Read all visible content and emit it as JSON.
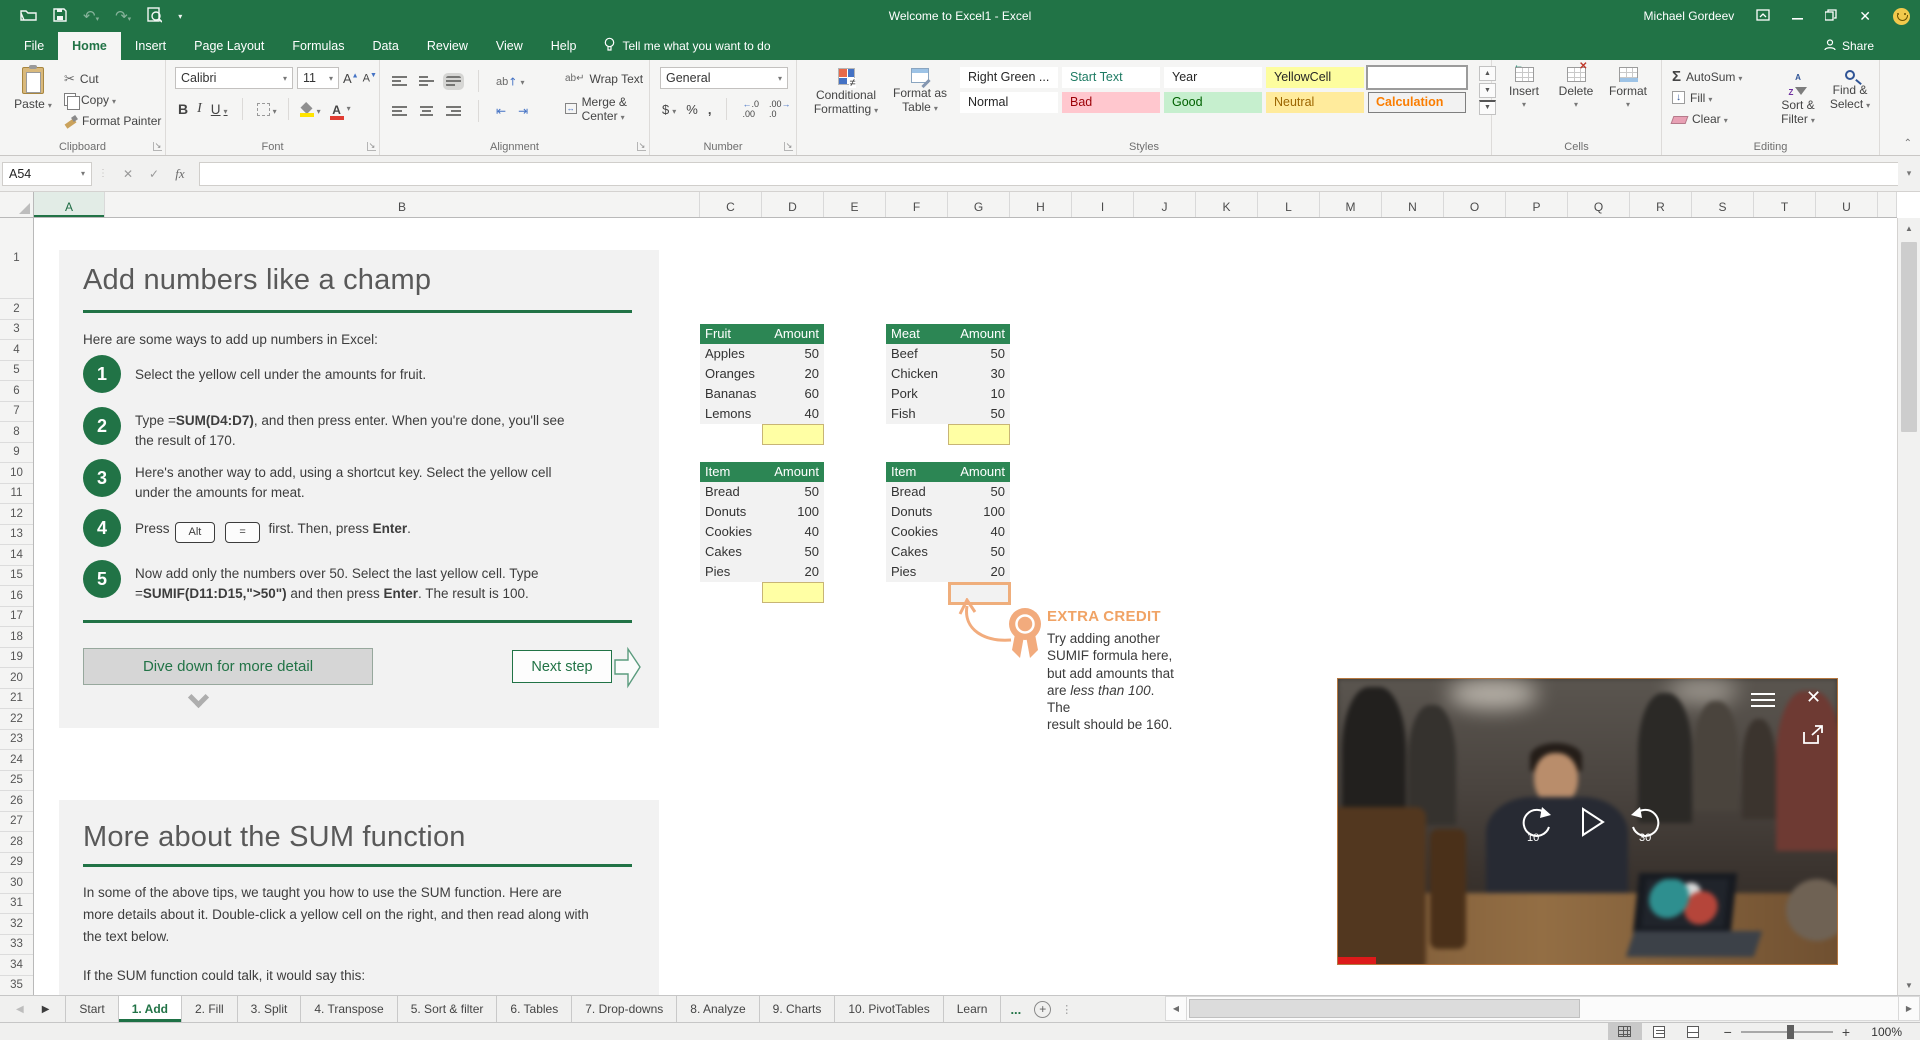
{
  "window": {
    "title": "Welcome to Excel1  -  Excel",
    "user": "Michael Gordeev",
    "share_label": "Share",
    "tell_me": "Tell me what you want to do"
  },
  "ribbon_tabs": [
    {
      "label": "File",
      "active": false
    },
    {
      "label": "Home",
      "active": true
    },
    {
      "label": "Insert",
      "active": false
    },
    {
      "label": "Page Layout",
      "active": false
    },
    {
      "label": "Formulas",
      "active": false
    },
    {
      "label": "Data",
      "active": false
    },
    {
      "label": "Review",
      "active": false
    },
    {
      "label": "View",
      "active": false
    },
    {
      "label": "Help",
      "active": false
    }
  ],
  "ribbon": {
    "clipboard": {
      "label": "Clipboard",
      "paste": "Paste",
      "cut": "Cut",
      "copy": "Copy",
      "format_painter": "Format Painter"
    },
    "font": {
      "label": "Font",
      "family": "Calibri",
      "size": "11"
    },
    "alignment": {
      "label": "Alignment",
      "wrap_text": "Wrap Text",
      "merge_center": "Merge & Center"
    },
    "number": {
      "label": "Number",
      "format": "General"
    },
    "styles": {
      "label": "Styles",
      "conditional_1": "Conditional",
      "conditional_2": "Formatting",
      "format_table_1": "Format as",
      "format_table_2": "Table",
      "gallery": [
        {
          "label": "Right Green ...",
          "fg": "#262626",
          "bg": "#ffffff"
        },
        {
          "label": "Start Text",
          "fg": "#1e7b63",
          "bg": "#ffffff"
        },
        {
          "label": "Year",
          "fg": "#262626",
          "bg": "#ffffff"
        },
        {
          "label": "YellowCell",
          "fg": "#262626",
          "bg": "#fdfd9e"
        },
        {
          "label": "",
          "fg": "#262626",
          "bg": "#ffffff",
          "selected": true
        },
        {
          "label": "Normal",
          "fg": "#262626",
          "bg": "#ffffff"
        },
        {
          "label": "Bad",
          "fg": "#9c0006",
          "bg": "#ffc7ce"
        },
        {
          "label": "Good",
          "fg": "#006100",
          "bg": "#c6efce"
        },
        {
          "label": "Neutral",
          "fg": "#9c6500",
          "bg": "#ffeb9c"
        },
        {
          "label": "Calculation",
          "fg": "#fa7d00",
          "bg": "#f2f2f2",
          "bold": true,
          "border": true
        }
      ]
    },
    "cells": {
      "label": "Cells",
      "insert": "Insert",
      "delete": "Delete",
      "format": "Format"
    },
    "editing": {
      "label": "Editing",
      "autosum": "AutoSum",
      "fill": "Fill",
      "clear": "Clear",
      "sort_1": "Sort &",
      "sort_2": "Filter",
      "find_1": "Find &",
      "find_2": "Select"
    }
  },
  "formula_bar": {
    "name_box": "A54",
    "formula": "",
    "cancel_icon": "✕",
    "enter_icon": "✓",
    "fx_icon": "fx"
  },
  "grid": {
    "columns": [
      "A",
      "B",
      "C",
      "D",
      "E",
      "F",
      "G",
      "H",
      "I",
      "J",
      "K",
      "L",
      "M",
      "N",
      "O",
      "P",
      "Q",
      "R",
      "S",
      "T",
      "U"
    ],
    "rows": [
      1,
      2,
      3,
      4,
      5,
      6,
      7,
      8,
      9,
      10,
      11,
      12,
      13,
      14,
      15,
      16,
      17,
      18,
      19,
      20,
      21,
      22,
      23,
      24,
      25,
      26,
      27,
      28,
      29,
      30,
      31,
      32,
      33,
      34,
      35
    ]
  },
  "panel1": {
    "title": "Add numbers like a champ",
    "intro": "Here are some ways to add up numbers in Excel:",
    "steps": [
      {
        "num": "1",
        "lines": [
          [
            {
              "t": "Select the yellow cell under the amounts for fruit."
            }
          ]
        ]
      },
      {
        "num": "2",
        "lines": [
          [
            {
              "t": "Type ="
            },
            {
              "t": "SUM(D4:D7)",
              "b": true
            },
            {
              "t": ", and then press enter. When you're done, you'll see"
            }
          ],
          [
            {
              "t": "the result of 170."
            }
          ]
        ]
      },
      {
        "num": "3",
        "lines": [
          [
            {
              "t": "Here's another way to add, using a shortcut key. Select the yellow cell"
            }
          ],
          [
            {
              "t": "under the amounts for meat."
            }
          ]
        ]
      },
      {
        "num": "4",
        "lines": [
          [
            {
              "t": "Press"
            },
            {
              "k": "Alt"
            },
            {
              "k": "="
            },
            {
              "t": " first. Then, press "
            },
            {
              "t": "Enter",
              "b": true
            },
            {
              "t": "."
            }
          ]
        ]
      },
      {
        "num": "5",
        "lines": [
          [
            {
              "t": "Now add only the numbers over 50. Select the last yellow cell. Type"
            }
          ],
          [
            {
              "t": "="
            },
            {
              "t": "SUMIF(D11:D15,\">50\")",
              "b": true
            },
            {
              "t": " and then press "
            },
            {
              "t": "Enter",
              "b": true
            },
            {
              "t": ". The result is 100."
            }
          ]
        ]
      }
    ],
    "dive_button": "Dive down for more detail",
    "next_button": "Next step"
  },
  "tables": {
    "fruit": {
      "headers": [
        "Fruit",
        "Amount"
      ],
      "rows": [
        [
          "Apples",
          "50"
        ],
        [
          "Oranges",
          "20"
        ],
        [
          "Bananas",
          "60"
        ],
        [
          "Lemons",
          "40"
        ]
      ],
      "footer": "yellow"
    },
    "meat": {
      "headers": [
        "Meat",
        "Amount"
      ],
      "rows": [
        [
          "Beef",
          "50"
        ],
        [
          "Chicken",
          "30"
        ],
        [
          "Pork",
          "10"
        ],
        [
          "Fish",
          "50"
        ]
      ],
      "footer": "yellow"
    },
    "item1": {
      "headers": [
        "Item",
        "Amount"
      ],
      "rows": [
        [
          "Bread",
          "50"
        ],
        [
          "Donuts",
          "100"
        ],
        [
          "Cookies",
          "40"
        ],
        [
          "Cakes",
          "50"
        ],
        [
          "Pies",
          "20"
        ]
      ],
      "footer": "yellow"
    },
    "item2": {
      "headers": [
        "Item",
        "Amount"
      ],
      "rows": [
        [
          "Bread",
          "50"
        ],
        [
          "Donuts",
          "100"
        ],
        [
          "Cookies",
          "40"
        ],
        [
          "Cakes",
          "50"
        ],
        [
          "Pies",
          "20"
        ]
      ],
      "footer": "orange"
    }
  },
  "extra_credit": {
    "heading": "EXTRA CREDIT",
    "lines": [
      [
        {
          "t": "Try adding another"
        }
      ],
      [
        {
          "t": "SUMIF formula here,"
        }
      ],
      [
        {
          "t": "but add amounts that"
        }
      ],
      [
        {
          "t": "are "
        },
        {
          "t": "less than 100",
          "i": true
        },
        {
          "t": ". The"
        }
      ],
      [
        {
          "t": "result should be 160."
        }
      ]
    ]
  },
  "panel2": {
    "title": "More about the SUM function",
    "para1_lines": [
      "In some of the above tips, we taught you how to use the SUM function. Here are",
      "more details about it. Double-click a yellow cell on the right, and then read along with",
      "the text below."
    ],
    "para2": "If the SUM function could talk, it would say this:"
  },
  "video": {
    "rewind_label": "10",
    "forward_label": "30"
  },
  "sheet_tabs": {
    "tabs": [
      {
        "label": "Start",
        "active": false
      },
      {
        "label": "1. Add",
        "active": true
      },
      {
        "label": "2. Fill",
        "active": false
      },
      {
        "label": "3. Split",
        "active": false
      },
      {
        "label": "4. Transpose",
        "active": false
      },
      {
        "label": "5. Sort & filter",
        "active": false
      },
      {
        "label": "6. Tables",
        "active": false
      },
      {
        "label": "7. Drop-downs",
        "active": false
      },
      {
        "label": "8. Analyze",
        "active": false
      },
      {
        "label": "9. Charts",
        "active": false
      },
      {
        "label": "10. PivotTables",
        "active": false
      },
      {
        "label": "Learn",
        "active": false
      }
    ],
    "overflow": "..."
  },
  "status_bar": {
    "zoom_level": "100%"
  },
  "colors": {
    "excel_green": "#217346",
    "table_header_green": "#2c8654",
    "yellow_cell": "#ffffa4",
    "peach_accent": "#f0a365"
  }
}
